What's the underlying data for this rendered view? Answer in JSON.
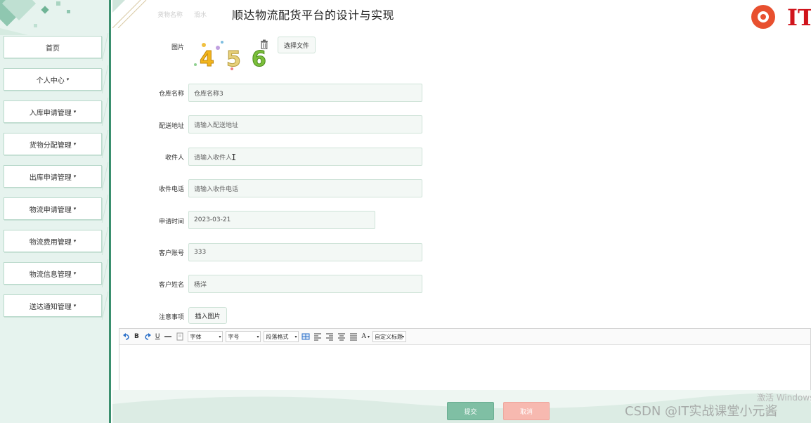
{
  "title": "顺达物流配货平台的设计与实现",
  "sidebar": {
    "items": [
      {
        "label": "首页",
        "caret": false
      },
      {
        "label": "个人中心",
        "caret": true
      },
      {
        "label": "入库申请管理",
        "caret": true
      },
      {
        "label": "货物分配管理",
        "caret": true
      },
      {
        "label": "出库申请管理",
        "caret": true
      },
      {
        "label": "物流申请管理",
        "caret": true
      },
      {
        "label": "物流费用管理",
        "caret": true
      },
      {
        "label": "物流信息管理",
        "caret": true
      },
      {
        "label": "送达通知管理",
        "caret": true
      }
    ],
    "caret_glyph": "▾"
  },
  "ghost_row": {
    "label": "货物名称",
    "value": "滑水"
  },
  "logo": {
    "text": "IT"
  },
  "form": {
    "image_label": "图片",
    "choose_file_label": "选择文件",
    "preview_digits": [
      "4",
      "5",
      "6"
    ],
    "fields": [
      {
        "label": "仓库名称",
        "value": "仓库名称3",
        "placeholder": ""
      },
      {
        "label": "配送地址",
        "value": "",
        "placeholder": "请输入配送地址"
      },
      {
        "label": "收件人",
        "value": "",
        "placeholder": "请输入收件人"
      },
      {
        "label": "收件电话",
        "value": "",
        "placeholder": "请输入收件电话"
      },
      {
        "label": "申请时间",
        "value": "2023-03-21",
        "placeholder": ""
      },
      {
        "label": "客户账号",
        "value": "333",
        "placeholder": ""
      },
      {
        "label": "客户姓名",
        "value": "杨洋",
        "placeholder": ""
      }
    ],
    "notes_label": "注意事项",
    "insert_image_label": "插入图片"
  },
  "editor": {
    "bold": "B",
    "underline": "U",
    "font_select": "字体",
    "size_select": "字号",
    "para_select": "段落格式",
    "font_color": "A",
    "custom_title": "自定义标题"
  },
  "actions": {
    "submit": "提交",
    "cancel": "取消"
  },
  "watermarks": {
    "windows": "激活 Windows",
    "csdn": "CSDN @IT实战课堂小元酱"
  },
  "colors": {
    "accent": "#3a8f6e",
    "submit": "#7fbfa4",
    "cancel": "#f7b9b0",
    "logo_red": "#d0141c"
  }
}
